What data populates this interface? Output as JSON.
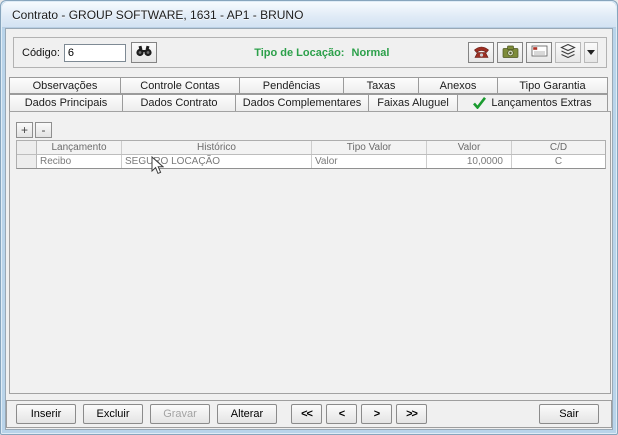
{
  "window": {
    "title": "Contrato - GROUP SOFTWARE, 1631 - AP1 - BRUNO"
  },
  "toolbar": {
    "codigo_label": "Código:",
    "codigo_value": "6",
    "tipo_locacao_label": "Tipo de Locação:",
    "tipo_locacao_value": "Normal",
    "icons": [
      "binoculars-icon",
      "phone-icon",
      "camera-icon",
      "envelope-icon",
      "layers-icon",
      "dropdown-arrow-icon"
    ]
  },
  "tabs": {
    "row1": [
      "Observações",
      "Controle Contas",
      "Pendências",
      "Taxas",
      "Anexos",
      "Tipo Garantia"
    ],
    "row2": [
      "Dados Principais",
      "Dados Contrato",
      "Dados Complementares",
      "Faixas Aluguel",
      "Lançamentos Extras"
    ],
    "active": "Lançamentos Extras"
  },
  "grid": {
    "add_button": "+",
    "remove_button": "-",
    "columns": [
      "Lançamento",
      "Histórico",
      "Tipo Valor",
      "Valor",
      "C/D"
    ],
    "rows": [
      {
        "lancamento": "Recibo",
        "historico": "SEGURO LOCAÇÃO",
        "tipo_valor": "Valor",
        "valor": "10,0000",
        "cd": "C"
      }
    ]
  },
  "footer": {
    "inserir": "Inserir",
    "excluir": "Excluir",
    "gravar": "Gravar",
    "alterar": "Alterar",
    "first": "<<",
    "prev": "<",
    "next": ">",
    "last": ">>",
    "sair": "Sair"
  },
  "colors": {
    "locacao_green": "#2ca04a",
    "check_green": "#1a9b2f",
    "phone_red": "#9c2f23",
    "camera_olive": "#7e8c3a",
    "frame_blue": "#b9d4ea"
  }
}
